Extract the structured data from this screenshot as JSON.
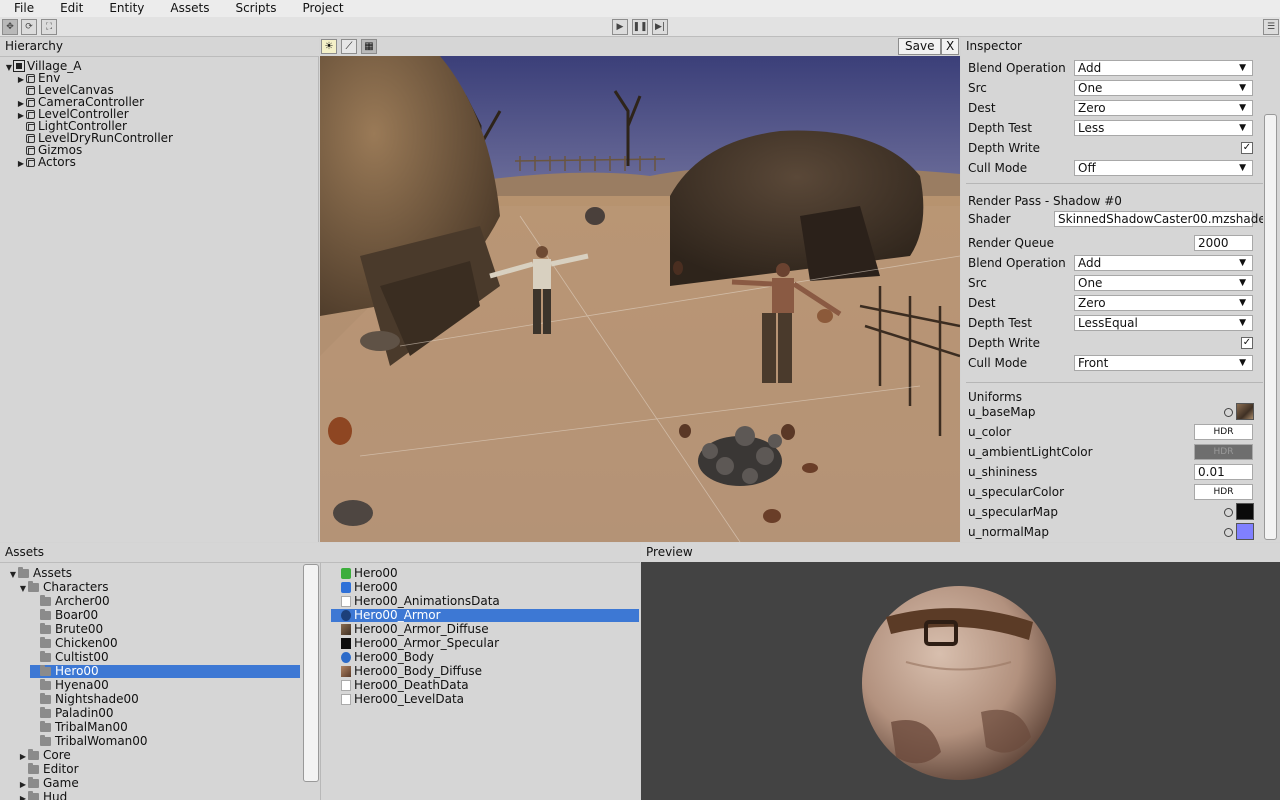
{
  "menu": [
    "File",
    "Edit",
    "Entity",
    "Assets",
    "Scripts",
    "Project"
  ],
  "toolbar": {
    "left_icons": [
      "move-icon",
      "rotate-icon",
      "scale-icon"
    ],
    "center_icons": [
      "play-icon",
      "pause-icon",
      "step-icon"
    ],
    "right_icon": "menu-icon"
  },
  "hierarchy": {
    "title": "Hierarchy",
    "items": [
      {
        "label": "Village_A",
        "level": 0,
        "arrow": "▼",
        "kind": "scene"
      },
      {
        "label": "Env",
        "level": 1,
        "arrow": "▶",
        "kind": "entity"
      },
      {
        "label": "LevelCanvas",
        "level": 1,
        "arrow": "",
        "kind": "entity"
      },
      {
        "label": "CameraController",
        "level": 1,
        "arrow": "▶",
        "kind": "entity"
      },
      {
        "label": "LevelController",
        "level": 1,
        "arrow": "▶",
        "kind": "entity"
      },
      {
        "label": "LightController",
        "level": 1,
        "arrow": "",
        "kind": "entity"
      },
      {
        "label": "LevelDryRunController",
        "level": 1,
        "arrow": "",
        "kind": "entity"
      },
      {
        "label": "Gizmos",
        "level": 1,
        "arrow": "",
        "kind": "entity"
      },
      {
        "label": "Actors",
        "level": 1,
        "arrow": "▶",
        "kind": "entity"
      }
    ]
  },
  "viewport": {
    "save_label": "Save",
    "close_label": "X",
    "icons": [
      "light-icon",
      "axis-icon",
      "grid-icon"
    ]
  },
  "inspector": {
    "title": "Inspector",
    "pass0": {
      "blend_label": "Blend Operation",
      "blend_value": "Add",
      "src_label": "Src",
      "src_value": "One",
      "dest_label": "Dest",
      "dest_value": "Zero",
      "depth_test_label": "Depth Test",
      "depth_test_value": "Less",
      "depth_write_label": "Depth Write",
      "depth_write_checked": "✓",
      "cull_label": "Cull Mode",
      "cull_value": "Off"
    },
    "shadow": {
      "heading": "Render Pass - Shadow #0",
      "shader_label": "Shader",
      "shader_value": "SkinnedShadowCaster00.mzshader",
      "queue_label": "Render Queue",
      "queue_value": "2000",
      "blend_label": "Blend Operation",
      "blend_value": "Add",
      "src_label": "Src",
      "src_value": "One",
      "dest_label": "Dest",
      "dest_value": "Zero",
      "depth_test_label": "Depth Test",
      "depth_test_value": "LessEqual",
      "depth_write_label": "Depth Write",
      "depth_write_checked": "✓",
      "cull_label": "Cull Mode",
      "cull_value": "Front"
    },
    "uniforms": {
      "heading": "Uniforms",
      "base_map": "u_baseMap",
      "color": "u_color",
      "ambient": "u_ambientLightColor",
      "shininess": "u_shininess",
      "shininess_value": "0.01",
      "specular_color": "u_specularColor",
      "specular_map": "u_specularMap",
      "normal_map": "u_normalMap",
      "hdr_label": "HDR"
    }
  },
  "assets": {
    "title": "Assets",
    "tree": [
      {
        "label": "Assets",
        "level": 0,
        "arrow": "▼"
      },
      {
        "label": "Characters",
        "level": 1,
        "arrow": "▼"
      },
      {
        "label": "Archer00",
        "level": 2,
        "arrow": ""
      },
      {
        "label": "Boar00",
        "level": 2,
        "arrow": ""
      },
      {
        "label": "Brute00",
        "level": 2,
        "arrow": ""
      },
      {
        "label": "Chicken00",
        "level": 2,
        "arrow": ""
      },
      {
        "label": "Cultist00",
        "level": 2,
        "arrow": ""
      },
      {
        "label": "Hero00",
        "level": 2,
        "arrow": "",
        "selected": true
      },
      {
        "label": "Hyena00",
        "level": 2,
        "arrow": ""
      },
      {
        "label": "Nightshade00",
        "level": 2,
        "arrow": ""
      },
      {
        "label": "Paladin00",
        "level": 2,
        "arrow": ""
      },
      {
        "label": "TribalMan00",
        "level": 2,
        "arrow": ""
      },
      {
        "label": "TribalWoman00",
        "level": 2,
        "arrow": ""
      },
      {
        "label": "Core",
        "level": 1,
        "arrow": "▶"
      },
      {
        "label": "Editor",
        "level": 1,
        "arrow": ""
      },
      {
        "label": "Game",
        "level": 1,
        "arrow": "▶"
      },
      {
        "label": "Hud",
        "level": 1,
        "arrow": "▶"
      }
    ],
    "files": [
      {
        "label": "Hero00",
        "icon": "prefab-icon"
      },
      {
        "label": "Hero00",
        "icon": "mesh-icon"
      },
      {
        "label": "Hero00_AnimationsData",
        "icon": "file-icon"
      },
      {
        "label": "Hero00_Armor",
        "icon": "material-icon",
        "selected": true
      },
      {
        "label": "Hero00_Armor_Diffuse",
        "icon": "texture-icon"
      },
      {
        "label": "Hero00_Armor_Specular",
        "icon": "texture-dark-icon"
      },
      {
        "label": "Hero00_Body",
        "icon": "material-icon"
      },
      {
        "label": "Hero00_Body_Diffuse",
        "icon": "texture-icon"
      },
      {
        "label": "Hero00_DeathData",
        "icon": "file-icon"
      },
      {
        "label": "Hero00_LevelData",
        "icon": "file-icon"
      }
    ]
  },
  "preview": {
    "title": "Preview"
  },
  "colors": {
    "selection": "#3d78d4",
    "panel": "#d6d6d6",
    "preview_bg": "#434343"
  }
}
